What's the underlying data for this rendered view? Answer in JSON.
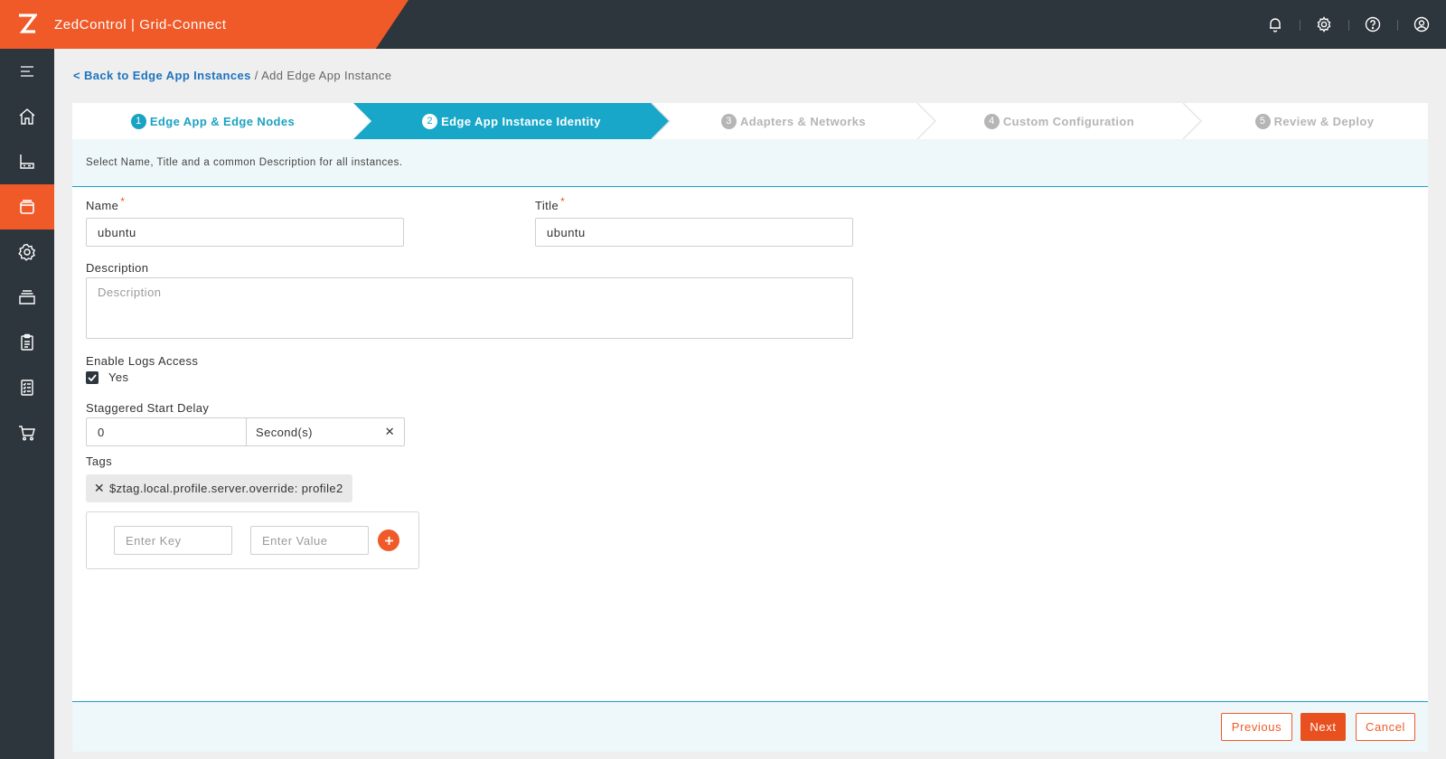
{
  "app": {
    "logo_letter": "Z",
    "title": "ZedControl | Grid-Connect"
  },
  "topbar": {
    "icons": [
      "bell-icon",
      "gear-icon",
      "help-icon",
      "user-icon"
    ]
  },
  "sidebar": {
    "items": [
      {
        "icon": "menu-icon"
      },
      {
        "icon": "home-icon"
      },
      {
        "icon": "edge-node-icon"
      },
      {
        "icon": "edge-app-icon",
        "active": true
      },
      {
        "icon": "network-icon"
      },
      {
        "icon": "storage-icon"
      },
      {
        "icon": "clipboard-icon"
      },
      {
        "icon": "checklist-icon"
      },
      {
        "icon": "cart-icon"
      }
    ]
  },
  "breadcrumb": {
    "back_link": "< Back to Edge App Instances",
    "separator": "/",
    "current": "Add Edge App Instance"
  },
  "steps": [
    {
      "num": "1",
      "label": "Edge App & Edge Nodes",
      "state": "done"
    },
    {
      "num": "2",
      "label": "Edge App Instance Identity",
      "state": "current"
    },
    {
      "num": "3",
      "label": "Adapters & Networks",
      "state": "pending"
    },
    {
      "num": "4",
      "label": "Custom Configuration",
      "state": "pending"
    },
    {
      "num": "5",
      "label": "Review & Deploy",
      "state": "pending"
    }
  ],
  "info_text": "Select Name, Title and a common Description for all instances.",
  "form": {
    "name_label": "Name",
    "name_value": "ubuntu",
    "title_label": "Title",
    "title_value": "ubuntu",
    "required_mark": "*",
    "description_label": "Description",
    "description_placeholder": "Description",
    "description_value": "",
    "logs_label": "Enable Logs Access",
    "logs_option": "Yes",
    "logs_checked": true,
    "delay_label": "Staggered Start Delay",
    "delay_value": "0",
    "delay_unit": "Second(s)",
    "tags_label": "Tags",
    "tags": [
      "$ztag.local.profile.server.override: profile2"
    ],
    "key_placeholder": "Enter Key",
    "value_placeholder": "Enter Value"
  },
  "footer": {
    "previous": "Previous",
    "next": "Next",
    "cancel": "Cancel"
  },
  "colors": {
    "brand_orange": "#f05a28",
    "step_teal": "#1aa2c2",
    "sidebar_dark": "#2d353d"
  }
}
